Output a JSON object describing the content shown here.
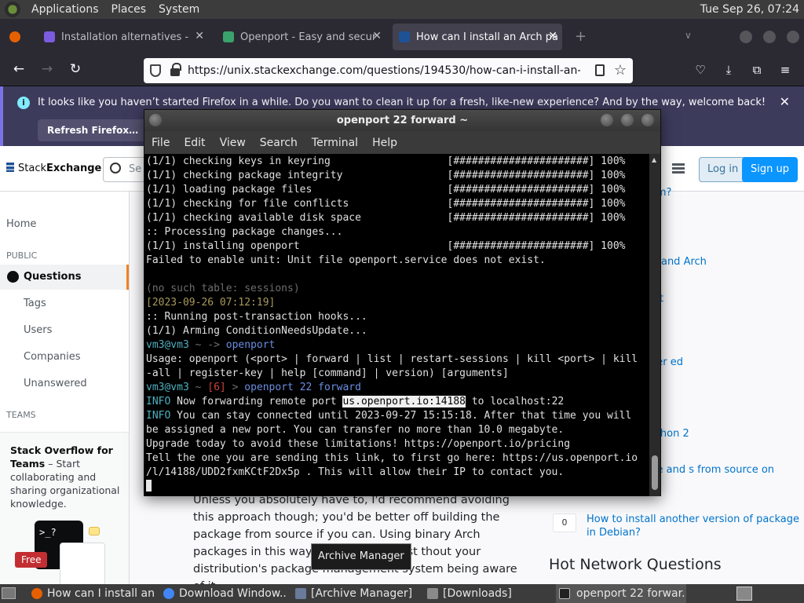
{
  "system_panel": {
    "menus": [
      "Applications",
      "Places",
      "System"
    ],
    "clock": "Tue Sep 26, 07:24"
  },
  "firefox": {
    "tabs": [
      {
        "label": "Installation alternatives -",
        "active": false
      },
      {
        "label": "Openport - Easy and secur",
        "active": false
      },
      {
        "label": "How can I install an Arch pa",
        "active": true
      }
    ],
    "url": "https://unix.stackexchange.com/questions/194530/how-can-i-install-an-arch-pa",
    "notification": {
      "message": "It looks like you haven’t started Firefox in a while. Do you want to clean it up for a fresh, like-new experience? And by the way, welcome back!",
      "button": "Refresh Firefox…"
    }
  },
  "stackexchange": {
    "logo_regular": "Stack",
    "logo_bold": "Exchange",
    "search_placeholder": "Se",
    "login": "Log in",
    "signup": "Sign up",
    "nav": {
      "home": "Home",
      "public_heading": "PUBLIC",
      "questions": "Questions",
      "tags": "Tags",
      "users": "Users",
      "companies": "Companies",
      "unanswered": "Unanswered",
      "teams_heading": "TEAMS"
    },
    "teams_promo": {
      "title": "Stack Overflow for Teams",
      "text": " – Start collaborating and sharing organizational knowledge.",
      "badge": "Free",
      "art_text": ">_?"
    },
    "answer_text": "Unless you absolutely have to, I'd recommend avoiding this approach though; you'd be better off building the package from source if you can. Using binary Arch packages in this way means you're inst          thout your distribution's package management system being aware of it,",
    "related": [
      "package to deb or rpm?",
      "ackage management and Arch",
      "package on Arch - Is it",
      ".9 on Arch Linux",
      "bian package manager ed system?",
      "ckage to all Debian",
      "thon-reportlab for python 2",
      "nstall Debian package and s from source on Ubuntu 18.04",
      "How to install another version of package in Debian?"
    ],
    "related_score": "0",
    "hot_network": "Hot Network Questions"
  },
  "terminal": {
    "title": "openport 22 forward ~",
    "menus": [
      "File",
      "Edit",
      "View",
      "Search",
      "Terminal",
      "Help"
    ],
    "lines": {
      "l1": "(1/1) checking keys in keyring                   [######################] 100%",
      "l2": "(1/1) checking package integrity                 [######################] 100%",
      "l3": "(1/1) loading package files                      [######################] 100%",
      "l4": "(1/1) checking for file conflicts                [######################] 100%",
      "l5": "(1/1) checking available disk space              [######################] 100%",
      "l6": ":: Processing package changes...",
      "l7": "(1/1) installing openport                        [######################] 100%",
      "l8": "Failed to enable unit: Unit file openport.service does not exist.",
      "l10": "(no such table: sessions)",
      "l11": "[2023-09-26 07:12:19]",
      "l12": ":: Running post-transaction hooks...",
      "l13": "(1/1) Arming ConditionNeedsUpdate...",
      "p1_user": "vm3@vm3",
      "p1_arrow": " ~ -> ",
      "p1_cmd": "openport",
      "l15": "Usage: openport (<port> | forward | list | restart-sessions | kill <port> | kill",
      "l16": "-all | register-key | help [command] | version) [arguments]",
      "p2_user": "vm3@vm3",
      "p2_dir": " ~ ",
      "p2_code": "[6]",
      "p2_arrow": " > ",
      "p2_cmd": "openport 22 forward",
      "i1_tag": "INFO",
      "i1_a": " Now forwarding remote port ",
      "i1_hl": "us.openport.io:14188",
      "i1_b": " to localhost:22",
      "i2_tag": "INFO",
      "i2_a": " You can stay connected until 2023-09-27 15:15:18. After that time you will",
      "l21": "be assigned a new port. You can transfer no more than 10.0 megabyte.",
      "l22": "Upgrade today to avoid these limitations! https://openport.io/pricing",
      "l23": "Tell the one you are sending this link, to first go here: https://us.openport.io",
      "l24": "/l/14188/UDD2fxmKCtF2Dx5p . This will allow their IP to contact you."
    }
  },
  "tooltip": "Archive Manager",
  "taskbar": [
    {
      "label": "How can I install an ...",
      "icon_color": "#e66000"
    },
    {
      "label": "Download Window...",
      "icon_color": "#4285f4"
    },
    {
      "label": "[Archive Manager]",
      "icon_color": "#6a7a9a"
    },
    {
      "label": "[Downloads]",
      "icon_color": "#8a8a8a"
    },
    {
      "label": "openport 22 forwar...",
      "icon_color": "#444444"
    }
  ]
}
